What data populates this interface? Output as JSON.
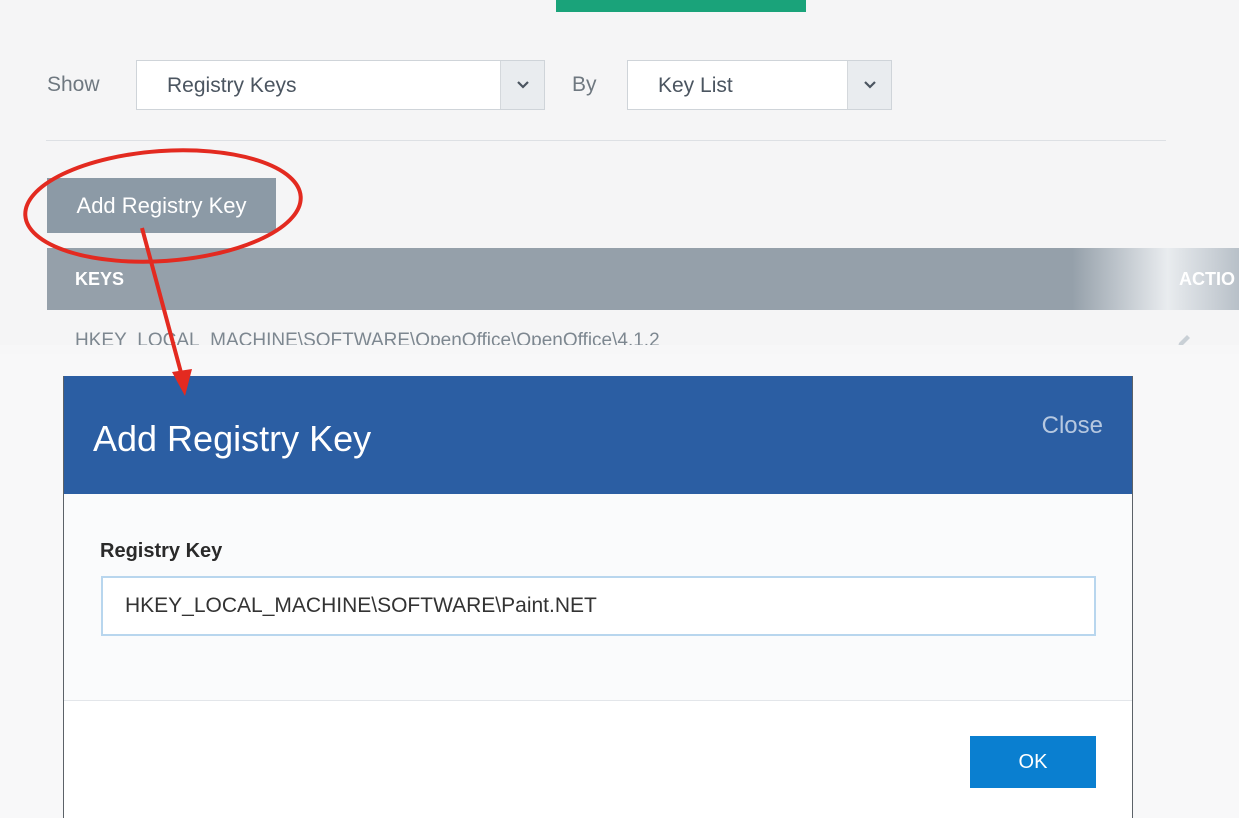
{
  "filters": {
    "show_label": "Show",
    "show_value": "Registry Keys",
    "by_label": "By",
    "by_value": "Key List"
  },
  "add_button_label": "Add Registry Key",
  "table": {
    "columns": [
      "KEYS",
      "ACTIO"
    ],
    "rows": [
      {
        "key": "HKEY_LOCAL_MACHINE\\SOFTWARE\\OpenOffice\\OpenOffice\\4.1.2"
      }
    ]
  },
  "modal": {
    "title": "Add Registry Key",
    "close_label": "Close",
    "field_label": "Registry Key",
    "field_value": "HKEY_LOCAL_MACHINE\\SOFTWARE\\Paint.NET",
    "ok_label": "OK"
  },
  "colors": {
    "tab_indicator": "#1aa37a",
    "modal_header": "#2b5ea3",
    "ok_button": "#0a7fd0",
    "add_button": "#8c9aa6",
    "annotation": "#e32a20"
  },
  "icons": [
    "chevron-down-icon",
    "pencil-icon"
  ]
}
